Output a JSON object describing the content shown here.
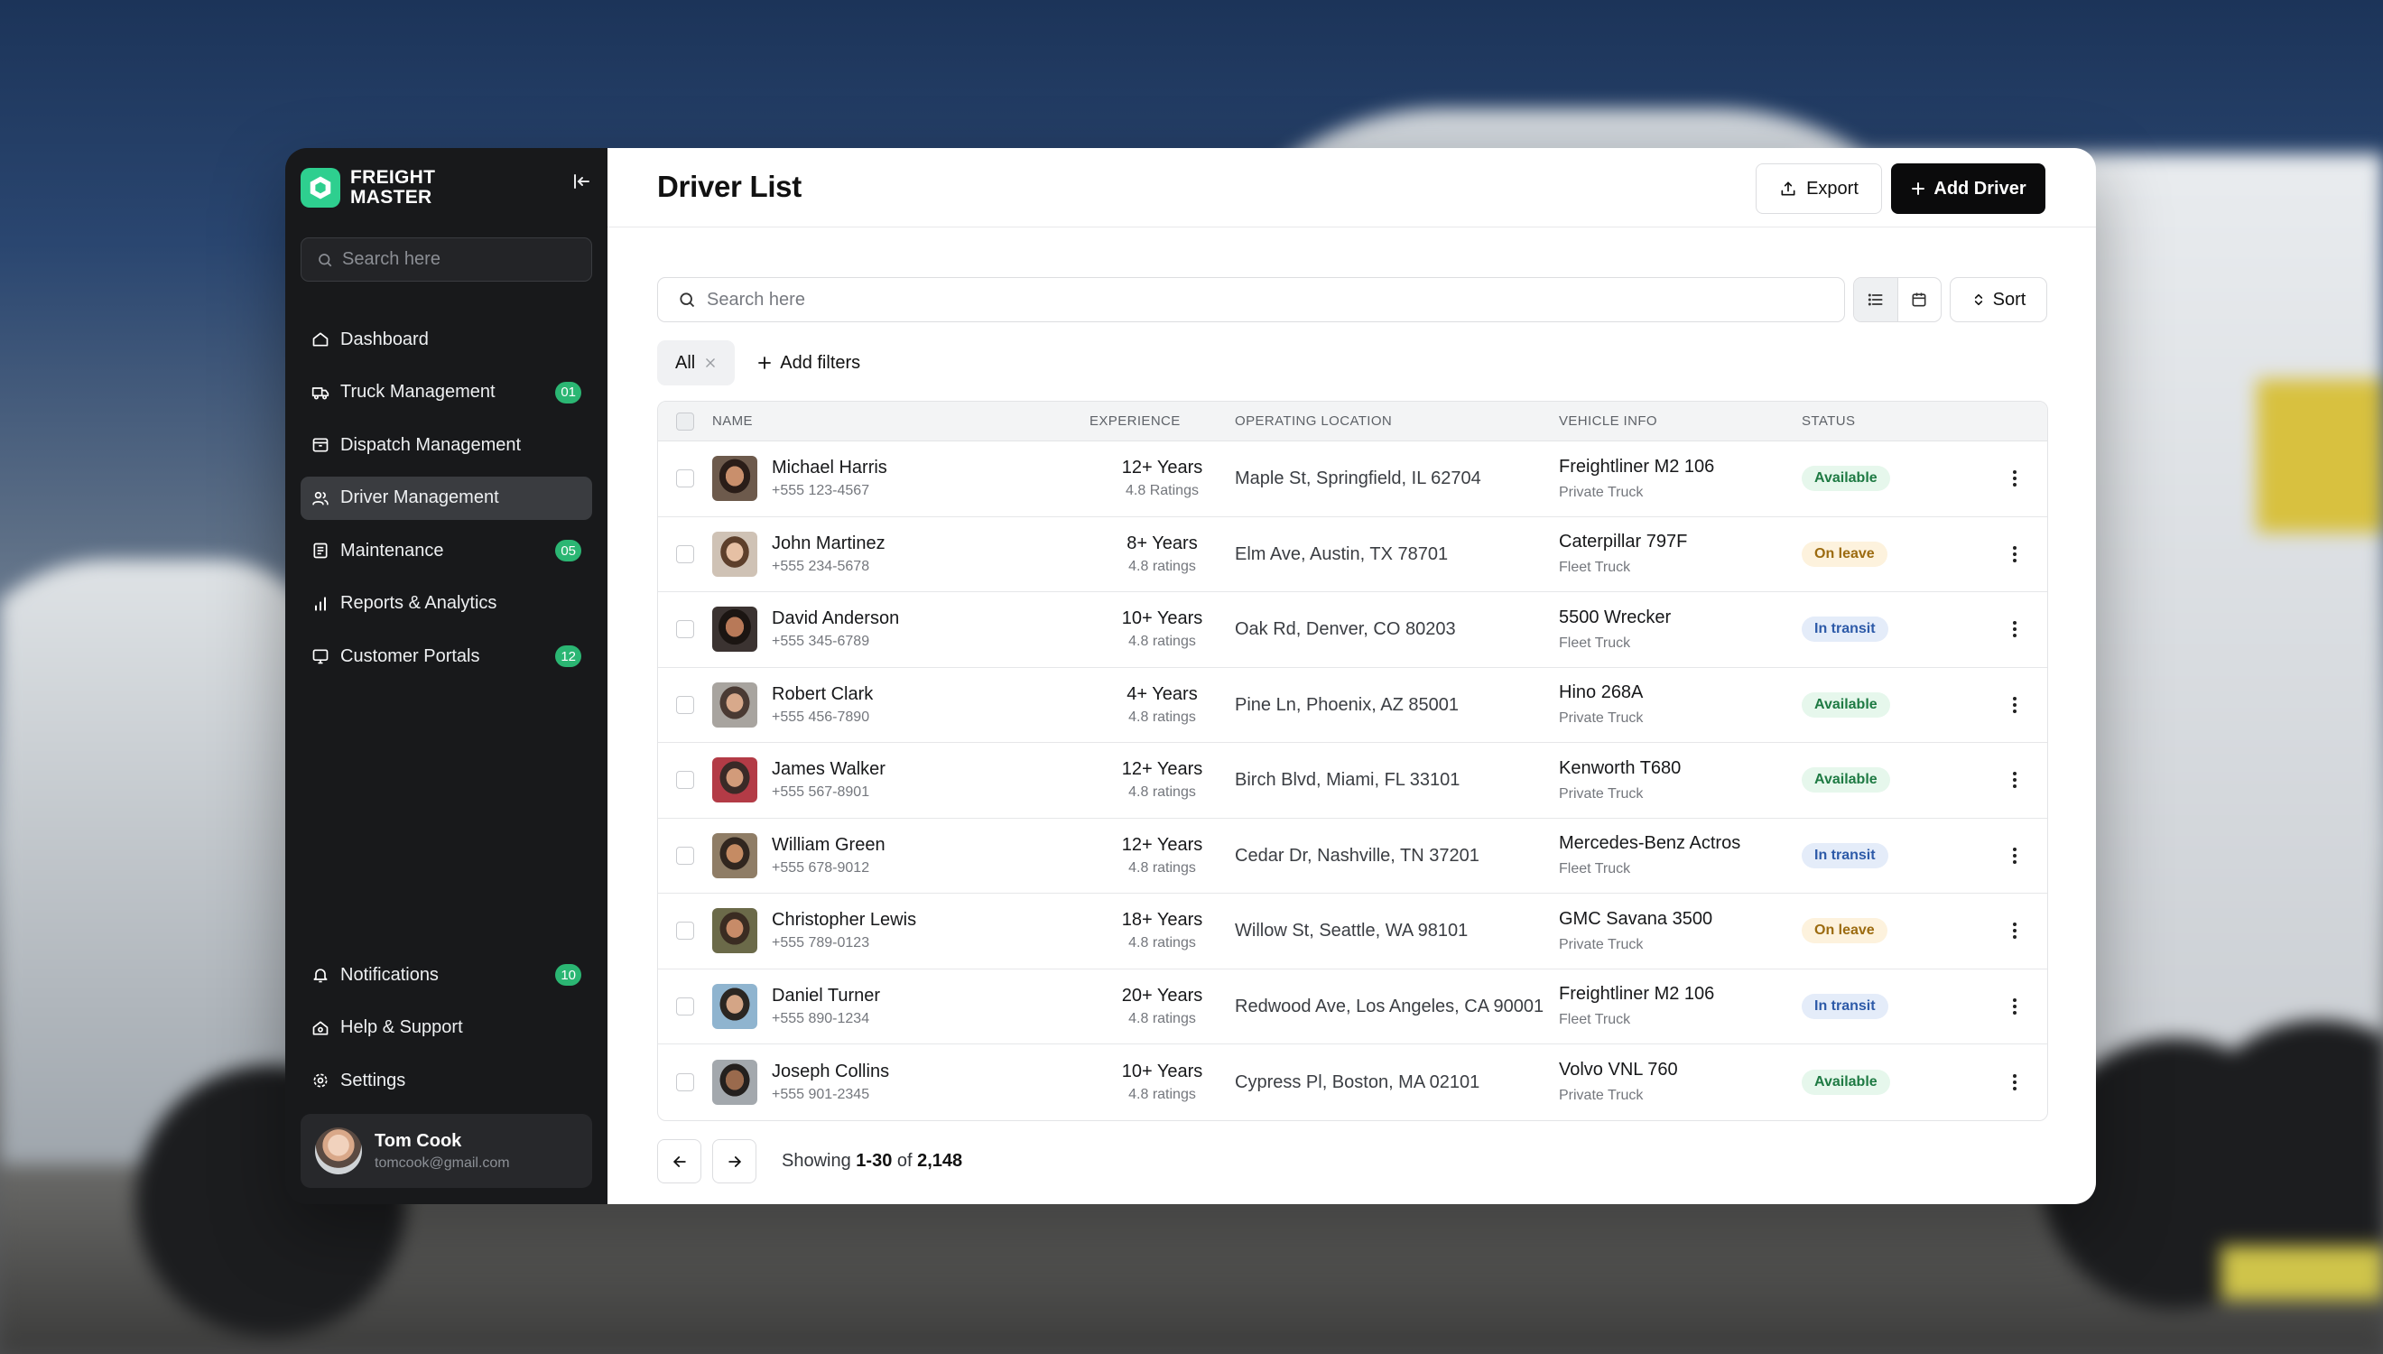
{
  "brand": {
    "line1": "FREIGHT",
    "line2": "MASTER"
  },
  "sidebar": {
    "search_placeholder": "Search here",
    "nav": [
      {
        "label": "Dashboard",
        "icon": "home-icon",
        "badge": ""
      },
      {
        "label": "Truck Management",
        "icon": "truck-icon",
        "badge": "01"
      },
      {
        "label": "Dispatch Management",
        "icon": "box-icon",
        "badge": ""
      },
      {
        "label": "Driver Management",
        "icon": "users-icon",
        "badge": "",
        "active": true
      },
      {
        "label": "Maintenance",
        "icon": "clipboard-icon",
        "badge": "05"
      },
      {
        "label": "Reports & Analytics",
        "icon": "bar-chart-icon",
        "badge": ""
      },
      {
        "label": "Customer Portals",
        "icon": "monitor-icon",
        "badge": "12"
      }
    ],
    "bottom_nav": [
      {
        "label": "Notifications",
        "icon": "bell-icon",
        "badge": "10"
      },
      {
        "label": "Help & Support",
        "icon": "help-home-icon",
        "badge": ""
      },
      {
        "label": "Settings",
        "icon": "gear-icon",
        "badge": ""
      }
    ],
    "user": {
      "name": "Tom Cook",
      "email": "tomcook@gmail.com"
    }
  },
  "header": {
    "title": "Driver List",
    "export_label": "Export",
    "add_label": "Add Driver"
  },
  "toolbar": {
    "search_placeholder": "Search here",
    "sort_label": "Sort"
  },
  "filters": {
    "all_label": "All",
    "add_filter_label": "Add filters"
  },
  "table": {
    "columns": [
      "NAME",
      "EXPERIENCE",
      "OPERATING LOCATION",
      "VEHICLE INFO",
      "STATUS"
    ],
    "rows": [
      {
        "name": "Michael Harris",
        "phone": "+555 123-4567",
        "years": "12+ Years",
        "ratings": "4.8 Ratings",
        "location": "Maple St, Springfield, IL 62704",
        "vehicle": "Freightliner M2 106",
        "vehicle_type": "Private Truck",
        "status": "Available"
      },
      {
        "name": "John Martinez",
        "phone": "+555 234-5678",
        "years": "8+ Years",
        "ratings": "4.8 ratings",
        "location": "Elm Ave, Austin, TX 78701",
        "vehicle": "Caterpillar 797F",
        "vehicle_type": "Fleet Truck",
        "status": "On leave"
      },
      {
        "name": "David Anderson",
        "phone": "+555 345-6789",
        "years": "10+ Years",
        "ratings": "4.8 ratings",
        "location": "Oak Rd, Denver, CO 80203",
        "vehicle": "5500 Wrecker",
        "vehicle_type": "Fleet Truck",
        "status": "In transit"
      },
      {
        "name": "Robert Clark",
        "phone": "+555 456-7890",
        "years": "4+ Years",
        "ratings": "4.8 ratings",
        "location": "Pine Ln, Phoenix, AZ 85001",
        "vehicle": "Hino 268A",
        "vehicle_type": "Private Truck",
        "status": "Available"
      },
      {
        "name": "James Walker",
        "phone": "+555 567-8901",
        "years": "12+ Years",
        "ratings": "4.8 ratings",
        "location": "Birch Blvd, Miami, FL 33101",
        "vehicle": "Kenworth T680",
        "vehicle_type": "Private Truck",
        "status": "Available"
      },
      {
        "name": "William Green",
        "phone": "+555 678-9012",
        "years": "12+ Years",
        "ratings": "4.8 ratings",
        "location": "Cedar Dr, Nashville, TN 37201",
        "vehicle": "Mercedes-Benz Actros",
        "vehicle_type": "Fleet Truck",
        "status": "In transit"
      },
      {
        "name": "Christopher Lewis",
        "phone": "+555 789-0123",
        "years": "18+ Years",
        "ratings": "4.8 ratings",
        "location": "Willow St, Seattle, WA 98101",
        "vehicle": "GMC Savana 3500",
        "vehicle_type": "Private Truck",
        "status": "On leave"
      },
      {
        "name": "Daniel Turner",
        "phone": "+555 890-1234",
        "years": "20+ Years",
        "ratings": "4.8 ratings",
        "location": "Redwood Ave, Los Angeles, CA 90001",
        "vehicle": "Freightliner M2 106",
        "vehicle_type": "Fleet Truck",
        "status": "In transit"
      },
      {
        "name": "Joseph Collins",
        "phone": "+555 901-2345",
        "years": "10+ Years",
        "ratings": "4.8 ratings",
        "location": "Cypress Pl, Boston, MA 02101",
        "vehicle": "Volvo VNL 760",
        "vehicle_type": "Private Truck",
        "status": "Available"
      }
    ]
  },
  "pagination": {
    "prefix": "Showing",
    "range": "1-30",
    "of": "of",
    "total": "2,148"
  },
  "colors": {
    "accent": "#2ecf8f",
    "badge": "#2bb673",
    "sidebar_bg": "#18191b",
    "primary_button": "#0b0b0c"
  }
}
